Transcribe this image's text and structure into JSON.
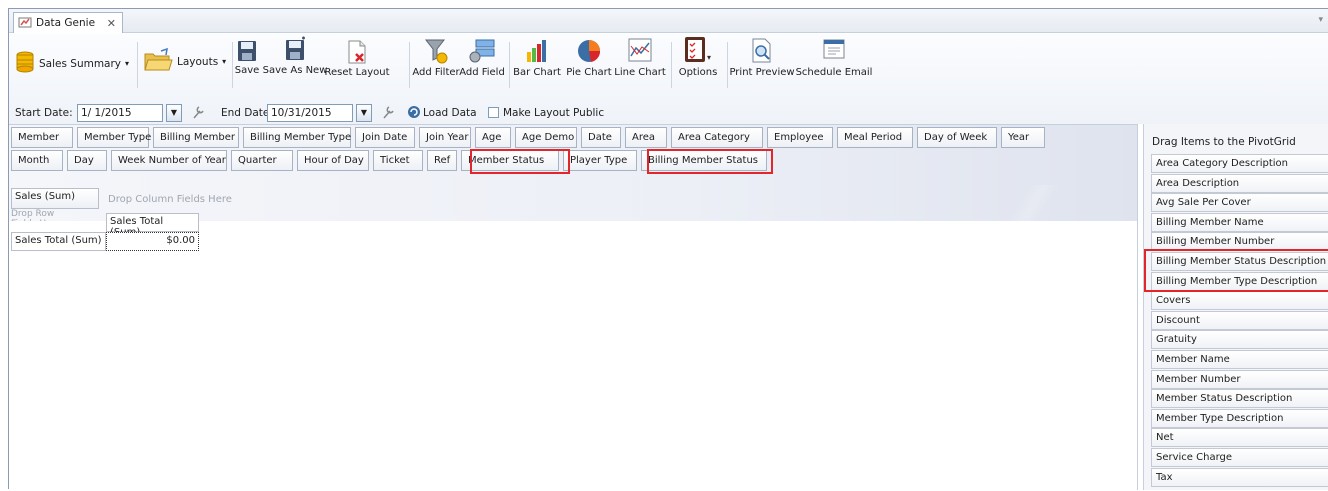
{
  "window": {
    "tab_title": "Data Genie",
    "tab_close": "✕",
    "tab_menu": "▾"
  },
  "ribbon": {
    "report_dropdown": "Sales Summary",
    "layouts": "Layouts",
    "save": "Save",
    "save_as_new": "Save As New",
    "reset_layout": "Reset Layout",
    "add_filter": "Add Filter",
    "add_field": "Add Field",
    "bar_chart": "Bar Chart",
    "pie_chart": "Pie Chart",
    "line_chart": "Line Chart",
    "options": "Options",
    "print_preview": "Print Preview",
    "schedule_email": "Schedule Email"
  },
  "dates": {
    "start_label": "Start Date:",
    "start_value": "1/ 1/2015",
    "end_label": "End Date:",
    "end_value": "10/31/2015",
    "load_data": "Load Data",
    "make_public": "Make Layout Public",
    "make_public_checked": false
  },
  "filter_fields_row1": [
    "Member",
    "Member Type",
    "Billing Member",
    "Billing Member Type",
    "Join Date",
    "Join Year",
    "Age",
    "Age Demo",
    "Date",
    "Area",
    "Area Category",
    "Employee",
    "Meal Period",
    "Day of Week",
    "Year"
  ],
  "filter_fields_row2": [
    "Month",
    "Day",
    "Week Number of Year",
    "Quarter",
    "Hour of Day",
    "Ticket",
    "Ref",
    "Member Status",
    "Player Type",
    "Billing Member Status"
  ],
  "pivot": {
    "data_field": "Sales (Sum)",
    "column_placeholder": "Drop Column Fields Here",
    "row_placeholder": "Drop Row Fields Here",
    "col_header": "Sales Total (Sum)",
    "row_header": "Sales Total (Sum)",
    "value": "$0.00"
  },
  "field_list": {
    "title": "Drag Items to the PivotGrid",
    "items": [
      "Area Category Description",
      "Area Description",
      "Avg Sale Per Cover",
      "Billing Member Name",
      "Billing Member Number",
      "Billing Member Status Description",
      "Billing Member Type Description",
      "Covers",
      "Discount",
      "Gratuity",
      "Member Name",
      "Member Number",
      "Member Status Description",
      "Member Type Description",
      "Net",
      "Service Charge",
      "Tax"
    ]
  },
  "colors": {
    "highlight": "#e3262b",
    "accent": "#3a6ea5"
  }
}
